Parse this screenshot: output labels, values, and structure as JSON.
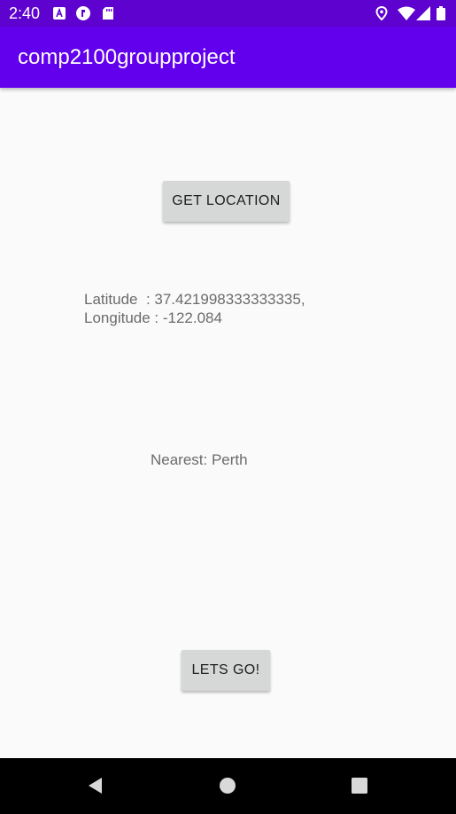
{
  "status_bar": {
    "time": "2:40",
    "notification_icons": [
      "a-letter-icon",
      "shield-icon",
      "sd-card-icon"
    ],
    "system_icons": [
      "location-pin-icon",
      "wifi-icon",
      "cell-signal-icon",
      "battery-icon"
    ]
  },
  "app_bar": {
    "title": "comp2100groupproject"
  },
  "main": {
    "get_location_label": "GET LOCATION",
    "latitude_text": "Latitude  : 37.421998333333335,",
    "longitude_text": "Longitude : -122.084",
    "nearest_text": "Nearest: Perth",
    "lets_go_label": "LETS GO!"
  },
  "nav_bar": {
    "buttons": [
      "back-icon",
      "home-icon",
      "recents-icon"
    ]
  },
  "colors": {
    "status_bar": "#5e02cf",
    "app_bar": "#6200ee",
    "background": "#fafafa",
    "button": "#d6d7d7",
    "secondary_text": "#6b6b6b",
    "nav_bar": "#000000"
  }
}
